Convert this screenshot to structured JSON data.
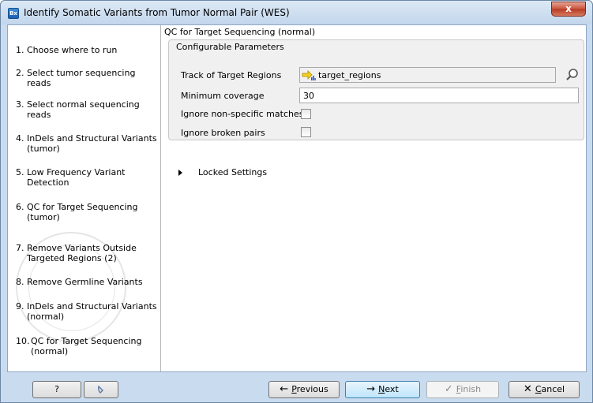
{
  "window": {
    "title": "Identify Somatic Variants from Tumor Normal Pair (WES)",
    "icon_text": "Bx",
    "close_glyph": "x"
  },
  "steps": [
    {
      "num": "1.",
      "label": "Choose where to run"
    },
    {
      "num": "2.",
      "label": "Select tumor sequencing reads"
    },
    {
      "num": "3.",
      "label": "Select normal sequencing reads"
    },
    {
      "num": "4.",
      "label": "InDels and Structural Variants (tumor)"
    },
    {
      "num": "5.",
      "label": "Low Frequency Variant Detection"
    },
    {
      "num": "6.",
      "label": "QC for Target Sequencing (tumor)"
    },
    {
      "num": "7.",
      "label": "Remove Variants Outside Targeted Regions (2)"
    },
    {
      "num": "8.",
      "label": "Remove Germline Variants"
    },
    {
      "num": "9.",
      "label": "InDels and Structural Variants (normal)"
    },
    {
      "num": "10.",
      "label": "QC for Target Sequencing (normal)"
    }
  ],
  "content": {
    "title": "QC for Target Sequencing (normal)",
    "group_title": "Configurable Parameters",
    "track_label": "Track of Target Regions",
    "track_value": "target_regions",
    "min_cov_label": "Minimum coverage",
    "min_cov_value": "30",
    "ignore_nonspecific_label": "Ignore non-specific matches",
    "ignore_nonspecific_checked": false,
    "ignore_broken_label": "Ignore broken pairs",
    "ignore_broken_checked": false,
    "locked_label": "Locked Settings"
  },
  "buttons": {
    "help": "?",
    "reset_icon": "undo-icon",
    "previous_pre": "",
    "previous_ul": "P",
    "previous_post": "revious",
    "next_ul": "N",
    "next_post": "ext",
    "finish_ul": "F",
    "finish_post": "inish",
    "cancel_ul": "C",
    "cancel_post": "ancel"
  },
  "colors": {
    "accent": "#3c7fb1",
    "frame": "#c9dbee",
    "close": "#c7503a"
  }
}
